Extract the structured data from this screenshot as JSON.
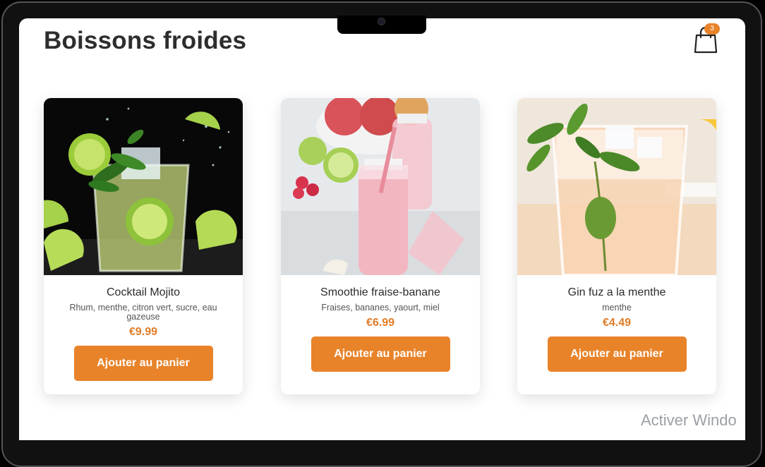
{
  "header": {
    "title": "Boissons froides",
    "cart_icon": "shopping-bag-icon",
    "cart_count": "3"
  },
  "colors": {
    "accent": "#e8832a",
    "price": "#e07c27",
    "title": "#2e2e2e"
  },
  "products": [
    {
      "name": "Cocktail Mojito",
      "description": "Rhum, menthe, citron vert, sucre, eau gazeuse",
      "price": "€9.99",
      "button": "Ajouter au panier",
      "image": "mojito-photo"
    },
    {
      "name": "Smoothie fraise-banane",
      "description": "Fraises, bananes, yaourt, miel",
      "price": "€6.99",
      "button": "Ajouter au panier",
      "image": "smoothie-photo"
    },
    {
      "name": "Gin fuz a la menthe",
      "description": "menthe",
      "price": "€4.49",
      "button": "Ajouter au panier",
      "image": "gin-photo"
    }
  ],
  "os_watermark": "Activer Windo"
}
